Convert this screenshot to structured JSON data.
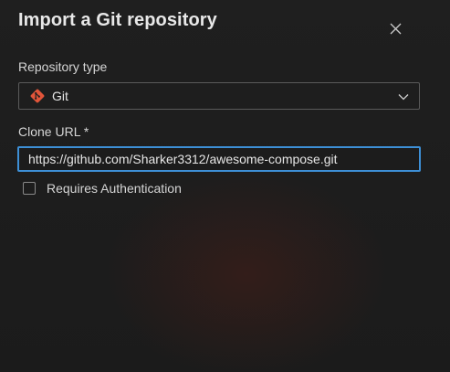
{
  "dialog": {
    "title": "Import a Git repository",
    "close_icon": "close-icon"
  },
  "repository_type": {
    "label": "Repository type",
    "selected": "Git",
    "icon": "git-icon",
    "dropdown_icon": "chevron-down-icon"
  },
  "clone_url": {
    "label": "Clone URL *",
    "value": "https://github.com/Sharker3312/awesome-compose.git"
  },
  "auth": {
    "label": "Requires Authentication",
    "checked": false
  },
  "colors": {
    "accent": "#3d8fd6",
    "git_brand": "#e2553a",
    "background": "#1c1c1c"
  }
}
